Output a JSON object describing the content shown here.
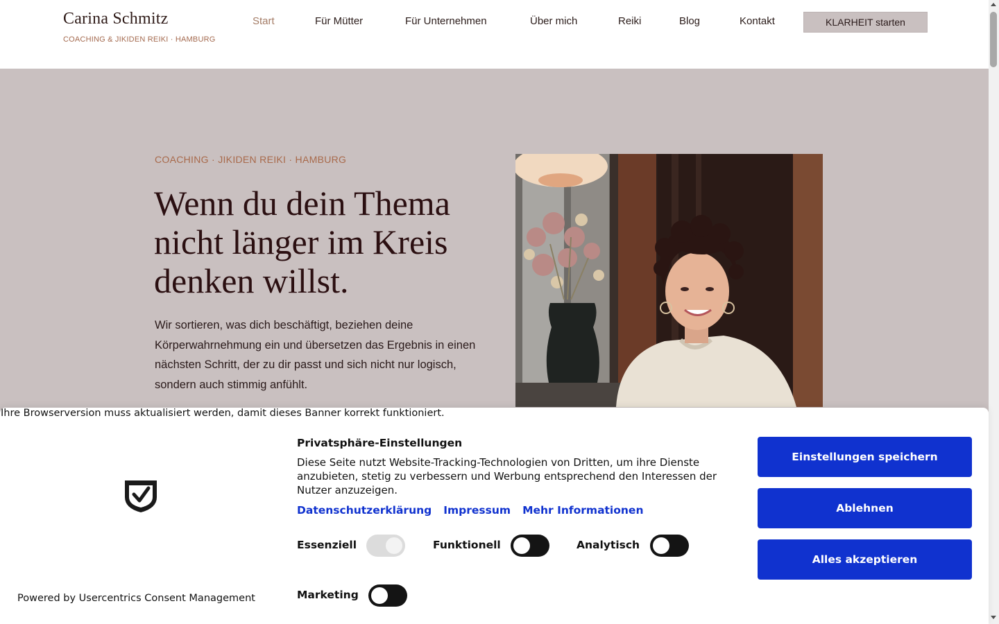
{
  "header": {
    "logo_name": "Carina Schmitz",
    "logo_tagline": "COACHING & JIKIDEN REIKI · HAMBURG",
    "nav": [
      {
        "label": "Start",
        "active": true
      },
      {
        "label": "Für Mütter"
      },
      {
        "label": "Für Unternehmen"
      },
      {
        "label": "Über mich"
      },
      {
        "label": "Reiki"
      },
      {
        "label": "Blog"
      },
      {
        "label": "Kontakt"
      }
    ],
    "cta_label": "KLARHEIT starten"
  },
  "hero": {
    "eyebrow": "COACHING · JIKIDEN REIKI · HAMBURG",
    "headline": "Wenn du dein Thema nicht länger im Kreis denken willst.",
    "lead": "Wir sortieren, was dich beschäftigt, beziehen deine Körperwahrnehmung ein und übersetzen das Ergebnis in einen nächsten Schritt, der zu dir passt und sich nicht nur logisch, sondern auch stimmig anfühlt."
  },
  "consent": {
    "outdated_notice": "Ihre Browserversion muss aktualisiert werden, damit dieses Banner korrekt funktioniert.",
    "title": "Privatsphäre-Einstellungen",
    "text": "Diese Seite nutzt Website-Tracking-Technologien von Dritten, um ihre Dienste anzubieten, stetig zu verbessern und Werbung entsprechend den Interessen der Nutzer anzuzeigen.",
    "links": [
      "Datenschutzerklärung",
      "Impressum",
      "Mehr Informationen"
    ],
    "toggles": [
      {
        "label": "Essenziell",
        "on": true,
        "disabled": true
      },
      {
        "label": "Funktionell",
        "on": false
      },
      {
        "label": "Analytisch",
        "on": false
      },
      {
        "label": "Marketing",
        "on": false
      }
    ],
    "buttons": {
      "save": "Einstellungen speichern",
      "deny": "Ablehnen",
      "accept_all": "Alles akzeptieren"
    },
    "powered_by": "Powered by Usercentrics Consent Management",
    "accent_color": "#1032cf"
  },
  "colors": {
    "hero_bg": "#c9c0c0",
    "headline": "#2b0f11",
    "eyebrow": "#a8694a",
    "nav_active": "#a47c66"
  }
}
